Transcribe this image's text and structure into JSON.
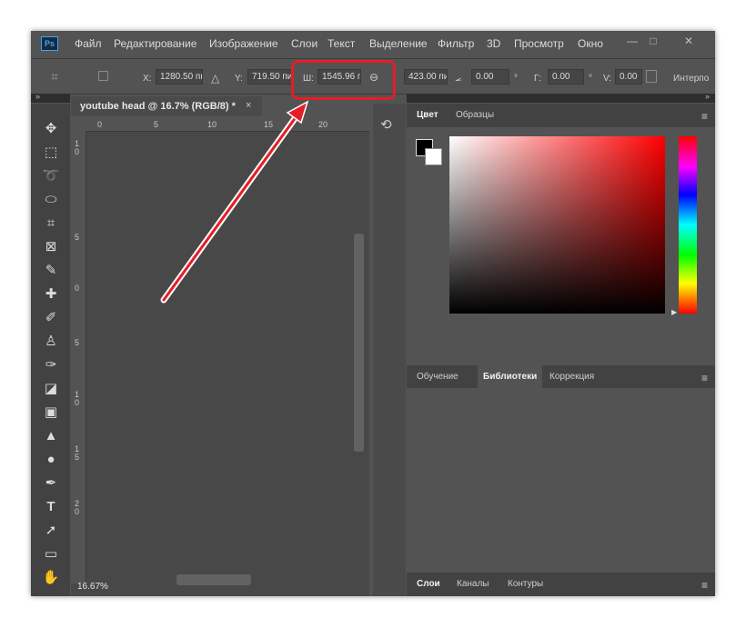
{
  "menu": {
    "logo": "Ps",
    "items": [
      "Файл",
      "Редактирование",
      "Изображение",
      "Слои",
      "Текст",
      "Выделение",
      "Фильтр",
      "3D",
      "Просмотр",
      "Окно"
    ],
    "window_controls": [
      "—",
      "□",
      "✕"
    ]
  },
  "options": {
    "x_label": "X:",
    "x_value": "1280.50 пи",
    "y_label": "Y:",
    "y_value": "719.50 пи",
    "w_label": "Ш:",
    "w_value": "1545.96 г",
    "h_value": "423.00 пи",
    "angle_value": "0.00",
    "degree": "°",
    "g_label": "Г:",
    "g_value": "0.00",
    "v_label": "V:",
    "v_value": "0.00",
    "interp": "Интерпо"
  },
  "document": {
    "tab_title": "youtube head @ 16.7% (RGB/8) *",
    "close": "×",
    "zoom": "16.67%",
    "ruler_top": [
      "0",
      "5",
      "10",
      "15",
      "20"
    ],
    "ruler_left": [
      "1\n0",
      "5",
      "0",
      "5",
      "1\n0",
      "1\n5",
      "2\n0"
    ]
  },
  "panels": {
    "color_tabs": [
      "Цвет",
      "Образцы"
    ],
    "library_tabs": [
      "Обучение",
      "Библиотеки",
      "Коррекция"
    ],
    "layer_tabs": [
      "Слои",
      "Каналы",
      "Контуры"
    ]
  },
  "colors": {
    "highlight": "#e41e26",
    "ps_blue": "#36a6ff"
  },
  "icons": [
    "move-icon",
    "marquee-icon",
    "lasso-icon",
    "quick-select-icon",
    "crop-icon",
    "frame-icon",
    "eyedropper-icon",
    "healing-icon",
    "brush-icon",
    "stamp-icon",
    "history-brush-icon",
    "eraser-icon",
    "gradient-icon",
    "blur-icon",
    "dodge-icon",
    "pen-icon",
    "text-icon",
    "path-select-icon",
    "rectangle-icon",
    "hand-icon",
    "link-icon"
  ]
}
